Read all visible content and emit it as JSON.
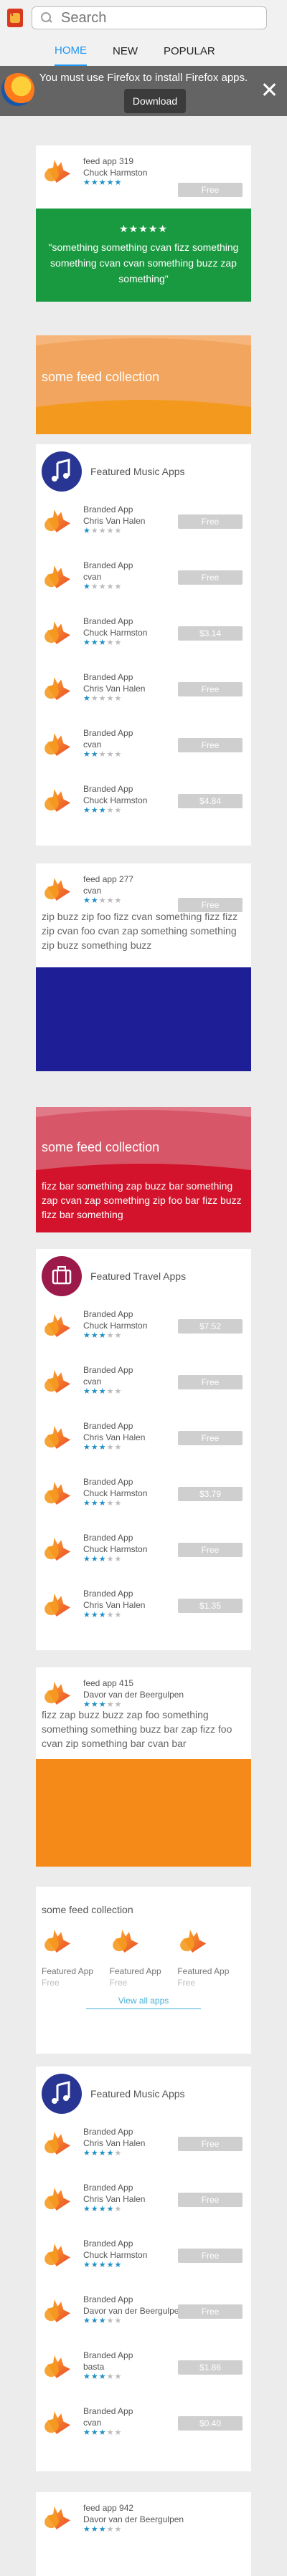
{
  "header": {
    "search_placeholder": "Search"
  },
  "tabs": [
    {
      "label": "HOME",
      "active": true
    },
    {
      "label": "NEW",
      "active": false
    },
    {
      "label": "POPULAR",
      "active": false
    }
  ],
  "banner": {
    "message": "You must use Firefox to install Firefox apps.",
    "button": "Download"
  },
  "colors": {
    "green": "#1a9a40",
    "orange": "#f39a1e",
    "navy": "#1e1e96",
    "red": "#d3132b",
    "pink": "#d75769",
    "accent": "#2196f3"
  },
  "feed1": {
    "title": "feed app 319",
    "author": "Chuck Harmston",
    "price": "Free",
    "rating": 5,
    "quote_stars": "★★★★★",
    "quote": "\"something something cvan fizz something something cvan cvan something buzz zap something\""
  },
  "collection1": {
    "title": "some feed collection"
  },
  "music1": {
    "title": "Featured Music Apps",
    "rows": [
      {
        "name": "Branded App",
        "author": "Chris Van Halen",
        "price": "Free",
        "rating": 1
      },
      {
        "name": "Branded App",
        "author": "cvan",
        "price": "Free",
        "rating": 1
      },
      {
        "name": "Branded App",
        "author": "Chuck Harmston",
        "price": "$3.14",
        "rating": 3
      },
      {
        "name": "Branded App",
        "author": "Chris Van Halen",
        "price": "Free",
        "rating": 1
      },
      {
        "name": "Branded App",
        "author": "cvan",
        "price": "Free",
        "rating": 2
      },
      {
        "name": "Branded App",
        "author": "Chuck Harmston",
        "price": "$4.84",
        "rating": 3
      }
    ]
  },
  "feed2": {
    "title": "feed app 277",
    "author": "cvan",
    "price": "Free",
    "rating": 2,
    "text": "zip buzz zip foo fizz cvan something fizz fizz zip cvan foo cvan zap something something zip buzz something buzz"
  },
  "collection2": {
    "title": "some feed collection",
    "text": "fizz bar something zap buzz bar something zap cvan zap something zip foo bar fizz buzz fizz bar something"
  },
  "travel": {
    "title": "Featured Travel Apps",
    "rows": [
      {
        "name": "Branded App",
        "author": "Chuck Harmston",
        "price": "$7.52",
        "rating": 3
      },
      {
        "name": "Branded App",
        "author": "cvan",
        "price": "Free",
        "rating": 3
      },
      {
        "name": "Branded App",
        "author": "Chris Van Halen",
        "price": "Free",
        "rating": 3
      },
      {
        "name": "Branded App",
        "author": "Chuck Harmston",
        "price": "$3.79",
        "rating": 3
      },
      {
        "name": "Branded App",
        "author": "Chuck Harmston",
        "price": "Free",
        "rating": 3
      },
      {
        "name": "Branded App",
        "author": "Chris Van Halen",
        "price": "$1.35",
        "rating": 3
      }
    ]
  },
  "feed3": {
    "title": "feed app 415",
    "author": "Davor van der Beergulpen",
    "rating": 3,
    "text": "fizz zap buzz buzz zap foo something something something buzz bar zap fizz foo cvan zip something bar cvan bar"
  },
  "collection3": {
    "title": "some feed collection",
    "apps": [
      {
        "name": "Featured App",
        "price": "Free"
      },
      {
        "name": "Featured App",
        "price": "Free"
      },
      {
        "name": "Featured App",
        "price": "Free"
      }
    ],
    "view_all": "View all apps"
  },
  "music2": {
    "title": "Featured Music Apps",
    "rows": [
      {
        "name": "Branded App",
        "author": "Chris Van Halen",
        "price": "Free",
        "rating": 4
      },
      {
        "name": "Branded App",
        "author": "Chris Van Halen",
        "price": "Free",
        "rating": 4
      },
      {
        "name": "Branded App",
        "author": "Chuck Harmston",
        "price": "Free",
        "rating": 5
      },
      {
        "name": "Branded App",
        "author": "Davor van der Beergulpen",
        "price": "Free",
        "rating": 3
      },
      {
        "name": "Branded App",
        "author": "basta",
        "price": "$1.86",
        "rating": 3
      },
      {
        "name": "Branded App",
        "author": "cvan",
        "price": "$0.40",
        "rating": 3
      }
    ]
  },
  "feed4": {
    "title": "feed app 942",
    "author": "Davor van der Beergulpen",
    "rating": 3
  }
}
